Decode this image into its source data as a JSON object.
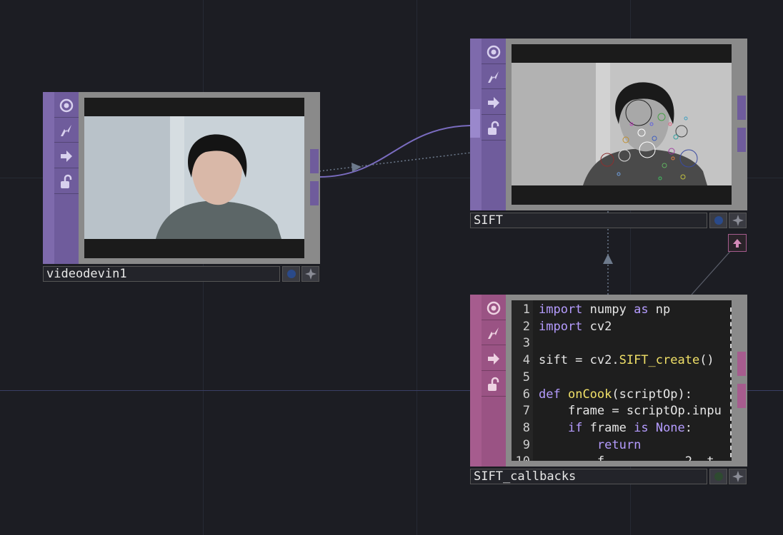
{
  "nodes": {
    "videodevin": {
      "name": "videodevin1",
      "color": "#7e6aac",
      "icons": [
        "viewer-icon",
        "cook-icon",
        "export-icon",
        "lock-icon"
      ]
    },
    "sift": {
      "name": "SIFT",
      "color": "#7e6aac",
      "icons": [
        "viewer-icon",
        "cook-icon",
        "export-icon",
        "lock-icon"
      ]
    },
    "callbacks": {
      "name": "SIFT_callbacks",
      "color": "#a65c8e",
      "icons": [
        "viewer-icon",
        "cook-icon",
        "export-icon",
        "lock-icon"
      ],
      "code_lines": [
        {
          "n": "1",
          "text": "import numpy as np"
        },
        {
          "n": "2",
          "text": "import cv2"
        },
        {
          "n": "3",
          "text": ""
        },
        {
          "n": "4",
          "text": "sift = cv2.SIFT_create()"
        },
        {
          "n": "5",
          "text": ""
        },
        {
          "n": "6",
          "text": "def onCook(scriptOp):"
        },
        {
          "n": "7",
          "text": "    frame = scriptOp.inpu"
        },
        {
          "n": "8",
          "text": "    if frame is None:"
        },
        {
          "n": "9",
          "text": "        return"
        },
        {
          "n": "10",
          "text": "        f           2  t"
        }
      ]
    }
  },
  "colors": {
    "background": "#1c1d23",
    "top_family": "#7e6aac",
    "dat_family": "#a65c8e",
    "wire": "#7a6cc0"
  }
}
